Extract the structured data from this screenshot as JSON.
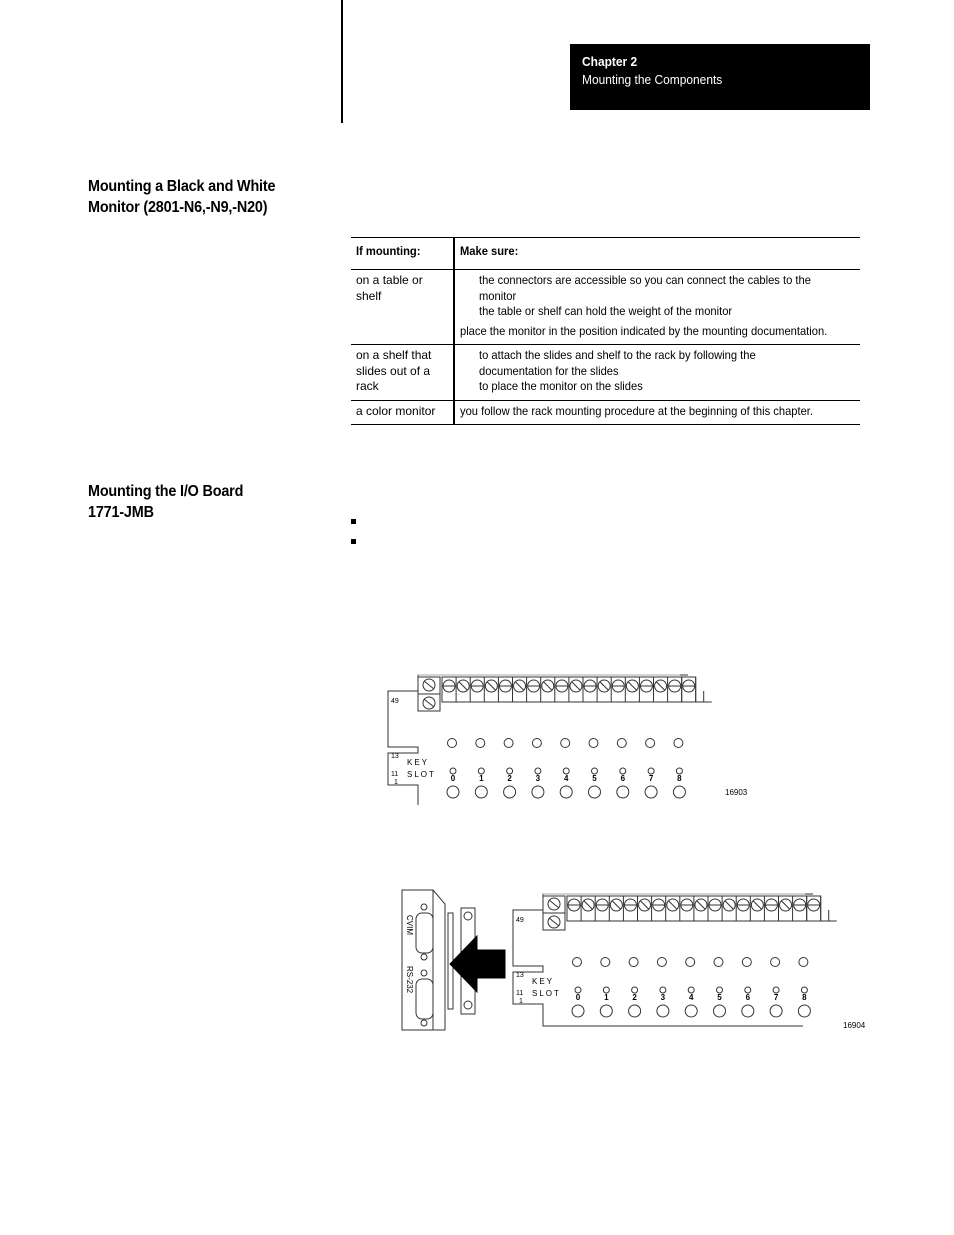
{
  "header": {
    "chapter_label": "Chapter  2",
    "chapter_title": "Mounting the Components"
  },
  "sections": [
    {
      "heading_line1": "Mounting a Black and White",
      "heading_line2": "Monitor (2801-N6,-N9,-N20)"
    },
    {
      "heading_line1": "Mounting the I/O Board",
      "heading_line2": "1771-JMB"
    }
  ],
  "mount_table": {
    "headers": [
      "If mounting:",
      "Make sure:"
    ],
    "rows": [
      {
        "condition": [
          "on a table or shelf"
        ],
        "requirements": [
          {
            "text": "the connectors are accessible so you can connect the cables to the",
            "indent": true
          },
          {
            "text": "monitor",
            "indent": true
          },
          {
            "text": "the table or shelf can hold the weight of the monitor",
            "indent": true
          },
          {
            "text": "place the monitor in the position indicated by the mounting documentation.",
            "indent": false
          }
        ]
      },
      {
        "condition": [
          "on a shelf that",
          "slides out of a rack"
        ],
        "requirements": [
          {
            "text": "to attach the slides and shelf to the rack by following the",
            "indent": true
          },
          {
            "text": "documentation for the slides",
            "indent": true
          },
          {
            "text": "to place the monitor on the slides",
            "indent": true
          }
        ]
      },
      {
        "condition": [
          "a color monitor"
        ],
        "requirements": [
          {
            "text": "you follow the rack mounting procedure at the beginning of this chapter.",
            "indent": false
          }
        ]
      }
    ]
  },
  "bullets": [
    "",
    ""
  ],
  "figures": [
    {
      "board_labels": {
        "top": "49",
        "mid": "13",
        "slot_a": "11",
        "slot_b": "1",
        "key": "KEY",
        "slot": "SLOT"
      },
      "channel_numbers": [
        "0",
        "1",
        "2",
        "3",
        "4",
        "5",
        "6",
        "7",
        "8"
      ],
      "figure_number": "16903"
    },
    {
      "board_labels": {
        "top": "49",
        "mid": "13",
        "slot_a": "11",
        "slot_b": "1",
        "key": "KEY",
        "slot": "SLOT"
      },
      "channel_numbers": [
        "0",
        "1",
        "2",
        "3",
        "4",
        "5",
        "6",
        "7",
        "8"
      ],
      "connector_labels": [
        "CVIM",
        "RS-232"
      ],
      "figure_number": "16904"
    }
  ]
}
